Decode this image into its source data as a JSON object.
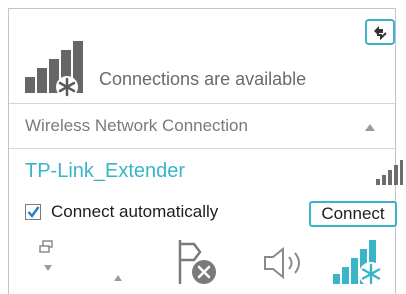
{
  "header": {
    "status_text": "Connections are available",
    "refresh_icon": "refresh-icon",
    "status_icon": "network-available-icon"
  },
  "section": {
    "title": "Wireless Network Connection",
    "collapse_icon": "chevron-up-icon"
  },
  "network": {
    "ssid": "TP-Link_Extender",
    "signal_icon": "wifi-signal-icon",
    "connect_automatically_label": "Connect automatically",
    "connect_automatically_checked": true,
    "connect_button_label": "Connect"
  },
  "taskbar": {
    "icons": [
      "show-desktop-icon",
      "chevron-down-icon",
      "chevron-up-icon",
      "action-center-error-icon",
      "volume-icon",
      "network-signal-icon"
    ]
  },
  "colors": {
    "accent": "#3ab4c8",
    "text_primary": "#1e1e1e",
    "text_secondary": "#6a6a6a",
    "icon_gray": "#6e6e6e"
  }
}
